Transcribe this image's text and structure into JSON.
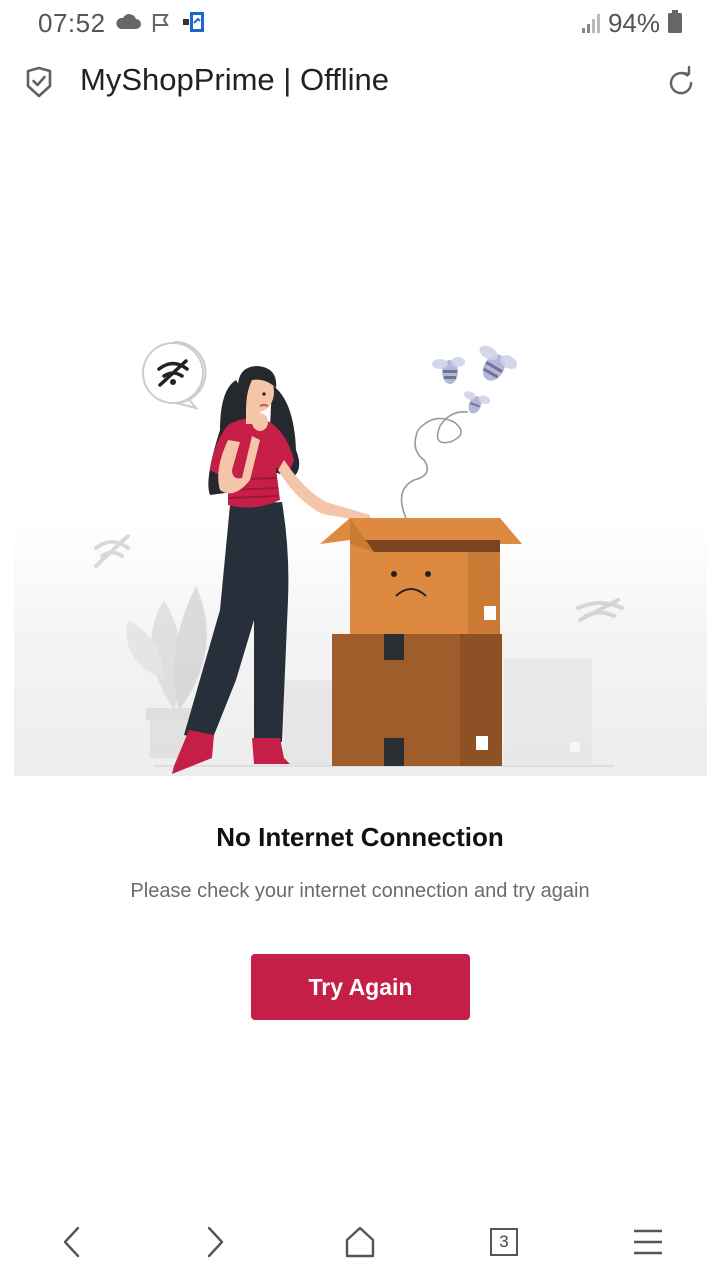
{
  "status_bar": {
    "time": "07:52",
    "battery": "94%",
    "icons": [
      "cloud-icon",
      "flag-icon",
      "sim-icon",
      "signal-icon",
      "battery-icon"
    ]
  },
  "toolbar": {
    "title": "MyShopPrime | Offline",
    "icons": [
      "shield-check-icon",
      "reload-icon"
    ]
  },
  "main": {
    "title": "No Internet Connection",
    "message": "Please check your internet connection and try again",
    "button_label": "Try Again"
  },
  "bottom_nav": {
    "tab_count": "3",
    "icons": [
      "back-icon",
      "forward-icon",
      "home-icon",
      "tabs-icon",
      "menu-icon"
    ]
  },
  "colors": {
    "accent": "#c51f48",
    "box_light": "#dd8a40",
    "box_dark": "#a05d2c"
  }
}
